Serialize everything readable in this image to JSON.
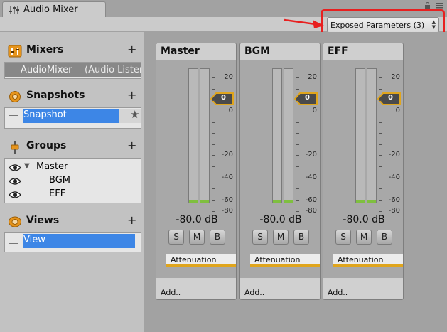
{
  "window": {
    "tab_title": "Audio Mixer"
  },
  "toolbar": {
    "exposed_parameters_label": "Exposed Parameters (3)"
  },
  "sections": {
    "mixers": {
      "title": "Mixers",
      "add": "+",
      "item_name": "AudioMixer",
      "item_sub": "(Audio Listener)"
    },
    "snapshots": {
      "title": "Snapshots",
      "add": "+",
      "item": "Snapshot"
    },
    "groups": {
      "title": "Groups",
      "add": "+",
      "items": [
        "Master",
        "BGM",
        "EFF"
      ]
    },
    "views": {
      "title": "Views",
      "add": "+",
      "item": "View"
    }
  },
  "strips": [
    {
      "name": "Master",
      "db": "-80.0 dB",
      "fader_value": "0",
      "effect": "Attenuation",
      "add": "Add.."
    },
    {
      "name": "BGM",
      "db": "-80.0 dB",
      "fader_value": "0",
      "effect": "Attenuation",
      "add": "Add.."
    },
    {
      "name": "EFF",
      "db": "-80.0 dB",
      "fader_value": "0",
      "effect": "Attenuation",
      "add": "Add.."
    }
  ],
  "strip_buttons": {
    "solo": "S",
    "mute": "M",
    "bypass": "B"
  },
  "scale_labels": [
    "20",
    "0",
    "-20",
    "-40",
    "-60",
    "-80"
  ],
  "colors": {
    "accent": "#e0a51c",
    "selection": "#3d86e6",
    "annotation": "#e82020",
    "meter": "#7fbf3f"
  }
}
